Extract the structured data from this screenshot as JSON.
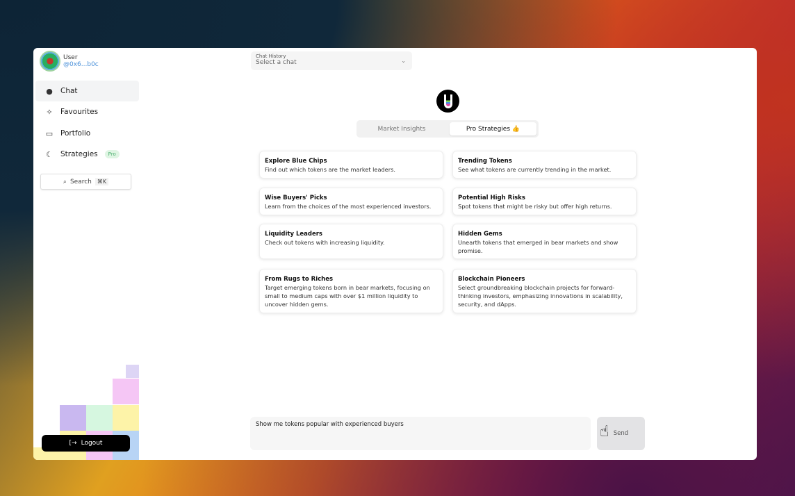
{
  "user": {
    "name": "User",
    "address": "@0x6...b0c"
  },
  "sidebar": {
    "items": [
      {
        "label": "Chat",
        "icon": "chat-bubble-icon"
      },
      {
        "label": "Favourites",
        "icon": "sparkles-icon"
      },
      {
        "label": "Portfolio",
        "icon": "wallet-icon"
      },
      {
        "label": "Strategies",
        "icon": "moon-gear-icon",
        "badge": "Pro"
      }
    ],
    "search_label": "Search",
    "search_shortcut": "⌘K",
    "logout_label": "Logout"
  },
  "chat_history": {
    "label": "Chat History",
    "placeholder": "Select a chat"
  },
  "tabs": [
    {
      "label": "Market Insights"
    },
    {
      "label": "Pro Strategies 👍"
    }
  ],
  "cards": [
    {
      "title": "Explore Blue Chips",
      "desc": "Find out which tokens are the market leaders."
    },
    {
      "title": "Trending Tokens",
      "desc": "See what tokens are currently trending in the market."
    },
    {
      "title": "Wise Buyers' Picks",
      "desc": "Learn from the choices of the most experienced investors."
    },
    {
      "title": "Potential High Risks",
      "desc": "Spot tokens that might be risky but offer high returns."
    },
    {
      "title": "Liquidity Leaders",
      "desc": "Check out tokens with increasing liquidity."
    },
    {
      "title": "Hidden Gems",
      "desc": "Unearth tokens that emerged in bear markets and show promise."
    },
    {
      "title": "From Rugs to Riches",
      "desc": "Target emerging tokens born in bear markets, focusing on small to medium caps with over $1 million liquidity to uncover hidden gems."
    },
    {
      "title": "Blockchain Pioneers",
      "desc": "Select groundbreaking blockchain projects for forward-thinking investors, emphasizing innovations in scalability, security, and dApps."
    }
  ],
  "composer": {
    "value": "Show me tokens popular with experienced buyers",
    "send_label": "Send"
  }
}
